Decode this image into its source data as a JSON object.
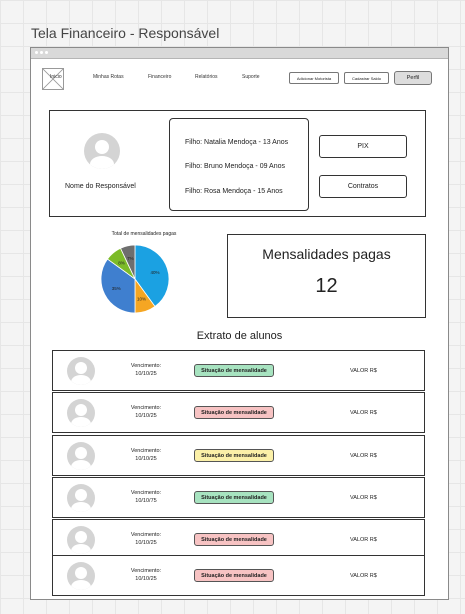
{
  "page_title": "Tela Financeiro - Responsável",
  "nav": {
    "logo": "",
    "items": [
      "Inicio",
      "Minhas Rotas",
      "Financeiro",
      "Relatórios",
      "Suporte"
    ],
    "buttons": [
      "Adicionar Motorista",
      "Cadastrar Saldo",
      "Perfil"
    ]
  },
  "profile": {
    "responsible_name": "Nome do Responsável",
    "children": [
      "Filho: Natalia Mendoça - 13 Anos",
      "Filho: Bruno Mendoça - 09 Anos",
      "Filho: Rosa Mendoça - 15 Anos"
    ],
    "actions": [
      "PIX",
      "Contratos"
    ]
  },
  "chart_data": {
    "type": "pie",
    "title": "Total de mensalidades pagas",
    "values": [
      40,
      10,
      35,
      8,
      7
    ],
    "labels": [
      "40%",
      "10%",
      "35%",
      "8%",
      "7%"
    ],
    "colors": [
      "#1ba1e2",
      "#f5a623",
      "#3f7fcf",
      "#7cbb28",
      "#6e6e6e"
    ]
  },
  "summary": {
    "label": "Mensalidades pagas",
    "value": "12"
  },
  "statement": {
    "title": "Extrato de alunos",
    "rows": [
      {
        "due_label": "Vencimento:",
        "due_date": "10/10/25",
        "status": "Situação de mensalidade",
        "status_color": "#a7e3c0",
        "value": "VALOR R$"
      },
      {
        "due_label": "Vencimento:",
        "due_date": "10/10/25",
        "status": "Situação de mensalidade",
        "status_color": "#f7c3c3",
        "value": "VALOR R$"
      },
      {
        "due_label": "Vencimento:",
        "due_date": "10/10/25",
        "status": "Situação de mensalidade",
        "status_color": "#fbf0a8",
        "value": "VALOR R$"
      },
      {
        "due_label": "Vencimento:",
        "due_date": "10/10/75",
        "status": "Situação de mensalidade",
        "status_color": "#a7e3c0",
        "value": "VALOR R$"
      },
      {
        "due_label": "Vencimento:",
        "due_date": "10/10/25",
        "status": "Situação de mensalidade",
        "status_color": "#f7c3c3",
        "value": "VALOR R$"
      },
      {
        "due_label": "Vencimento:",
        "due_date": "10/10/25",
        "status": "Situação de mensalidade",
        "status_color": "#f7c3c3",
        "value": "VALOR R$"
      }
    ]
  },
  "icons": {
    "avatar": "user-avatar-icon",
    "logo": "image-placeholder-icon"
  }
}
